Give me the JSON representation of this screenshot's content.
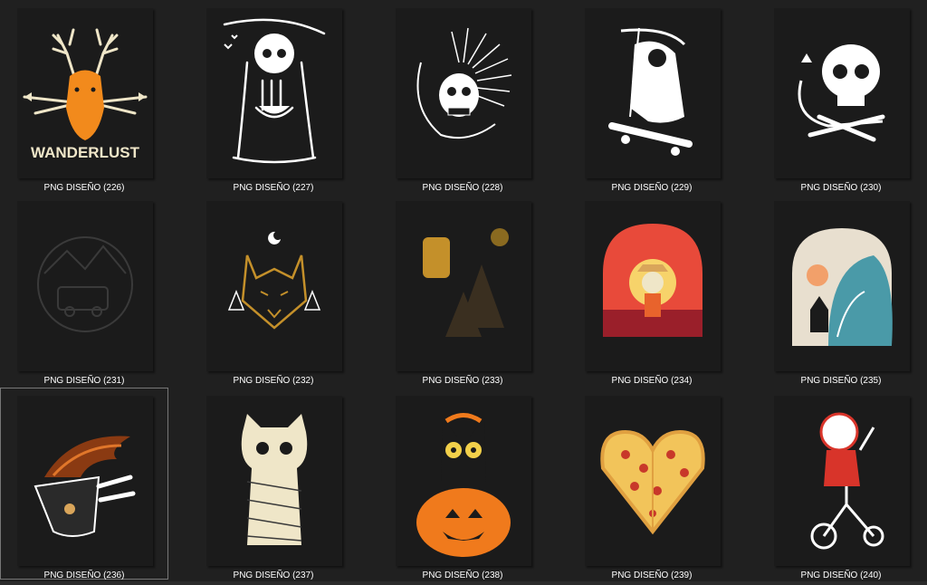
{
  "files": [
    {
      "label": "PNG DISEÑO (226)",
      "icon": "deer-wanderlust-icon",
      "art_text": "WANDERLUST",
      "selected": false
    },
    {
      "label": "PNG DISEÑO (227)",
      "icon": "skeleton-ramen-icon",
      "selected": false
    },
    {
      "label": "PNG DISEÑO (228)",
      "icon": "punk-skull-icon",
      "selected": false
    },
    {
      "label": "PNG DISEÑO (229)",
      "icon": "reaper-skateboard-icon",
      "selected": false
    },
    {
      "label": "PNG DISEÑO (230)",
      "icon": "skull-cat-icon",
      "selected": false
    },
    {
      "label": "PNG DISEÑO (231)",
      "icon": "van-camping-icon",
      "selected": false
    },
    {
      "label": "PNG DISEÑO (232)",
      "icon": "wolf-moon-icon",
      "selected": false
    },
    {
      "label": "PNG DISEÑO (233)",
      "icon": "backpack-mountains-icon",
      "selected": false
    },
    {
      "label": "PNG DISEÑO (234)",
      "icon": "skeleton-beach-icon",
      "selected": false
    },
    {
      "label": "PNG DISEÑO (235)",
      "icon": "reaper-wave-icon",
      "selected": false
    },
    {
      "label": "PNG DISEÑO (236)",
      "icon": "flaming-coffee-icon",
      "selected": true
    },
    {
      "label": "PNG DISEÑO (237)",
      "icon": "mummy-cat-icon",
      "selected": false
    },
    {
      "label": "PNG DISEÑO (238)",
      "icon": "cat-pumpkin-icon",
      "selected": false
    },
    {
      "label": "PNG DISEÑO (239)",
      "icon": "pizza-heart-icon",
      "selected": false
    },
    {
      "label": "PNG DISEÑO (240)",
      "icon": "skeleton-tricycle-icon",
      "selected": false
    }
  ],
  "colors": {
    "background": "#202020",
    "thumb_background": "#1b1b1b",
    "label_text": "#ffffff",
    "selection_border": "#777777",
    "orange": "#f28a1c",
    "gold": "#c4902a",
    "cream": "#efe6c8"
  }
}
